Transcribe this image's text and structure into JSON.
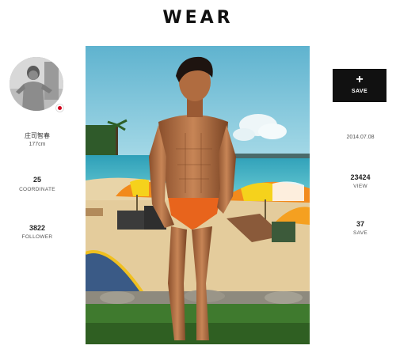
{
  "header": {
    "logo": "WEAR"
  },
  "profile": {
    "name": "庄司智春",
    "height": "177cm",
    "coordinate_count": "25",
    "coordinate_label": "COORDINATE",
    "follower_count": "3822",
    "follower_label": "FOLLOWER"
  },
  "post": {
    "save_button_icon": "+",
    "save_button_label": "SAVE",
    "date": "2014.07.08",
    "view_count": "23424",
    "view_label": "VIEW",
    "save_count": "37",
    "save_label": "SAVE"
  },
  "colors": {
    "sky": "#7ec8dd",
    "sea": "#3fb3c4",
    "sand": "#e8d4a8",
    "grass": "#3f7a2e",
    "skin": "#b8744a",
    "swimwear": "#e8641c",
    "umbrella_orange": "#f28a1c",
    "umbrella_yellow": "#f5d21c"
  },
  "icons": [
    "plus-icon",
    "japan-flag-icon"
  ]
}
